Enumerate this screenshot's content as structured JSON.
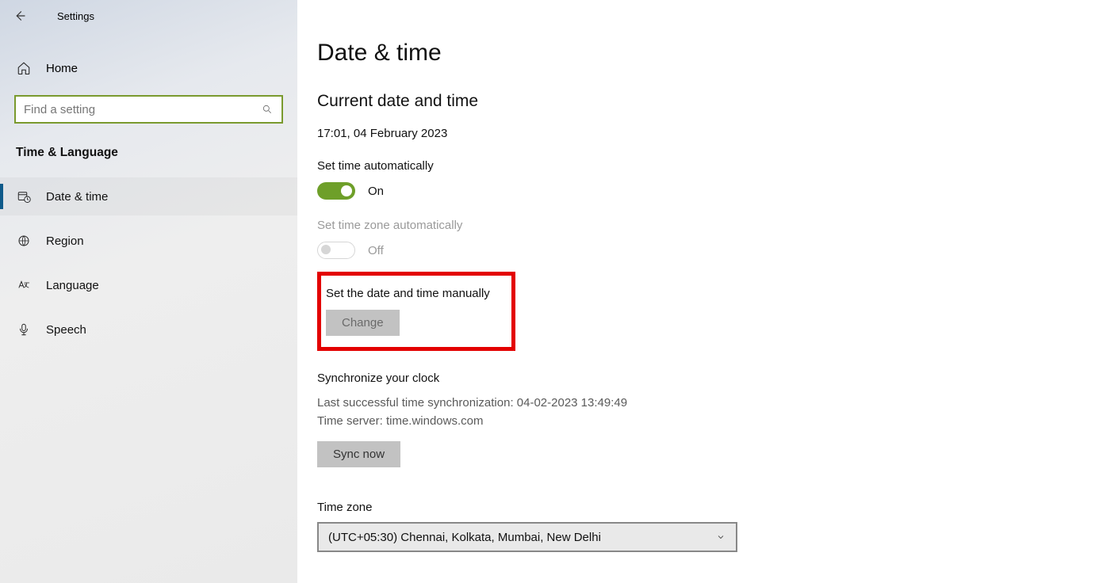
{
  "header": {
    "title": "Settings"
  },
  "sidebar": {
    "home_label": "Home",
    "search_placeholder": "Find a setting",
    "category": "Time & Language",
    "items": [
      {
        "label": "Date & time"
      },
      {
        "label": "Region"
      },
      {
        "label": "Language"
      },
      {
        "label": "Speech"
      }
    ]
  },
  "page": {
    "title": "Date & time",
    "current_heading": "Current date and time",
    "current_value": "17:01, 04 February 2023",
    "auto_time_label": "Set time automatically",
    "auto_time_state": "On",
    "auto_tz_label": "Set time zone automatically",
    "auto_tz_state": "Off",
    "manual_label": "Set the date and time manually",
    "change_button": "Change",
    "sync_heading": "Synchronize your clock",
    "sync_last": "Last successful time synchronization: 04-02-2023 13:49:49",
    "sync_server": "Time server: time.windows.com",
    "sync_button": "Sync now",
    "tz_label": "Time zone",
    "tz_value": "(UTC+05:30) Chennai, Kolkata, Mumbai, New Delhi"
  }
}
